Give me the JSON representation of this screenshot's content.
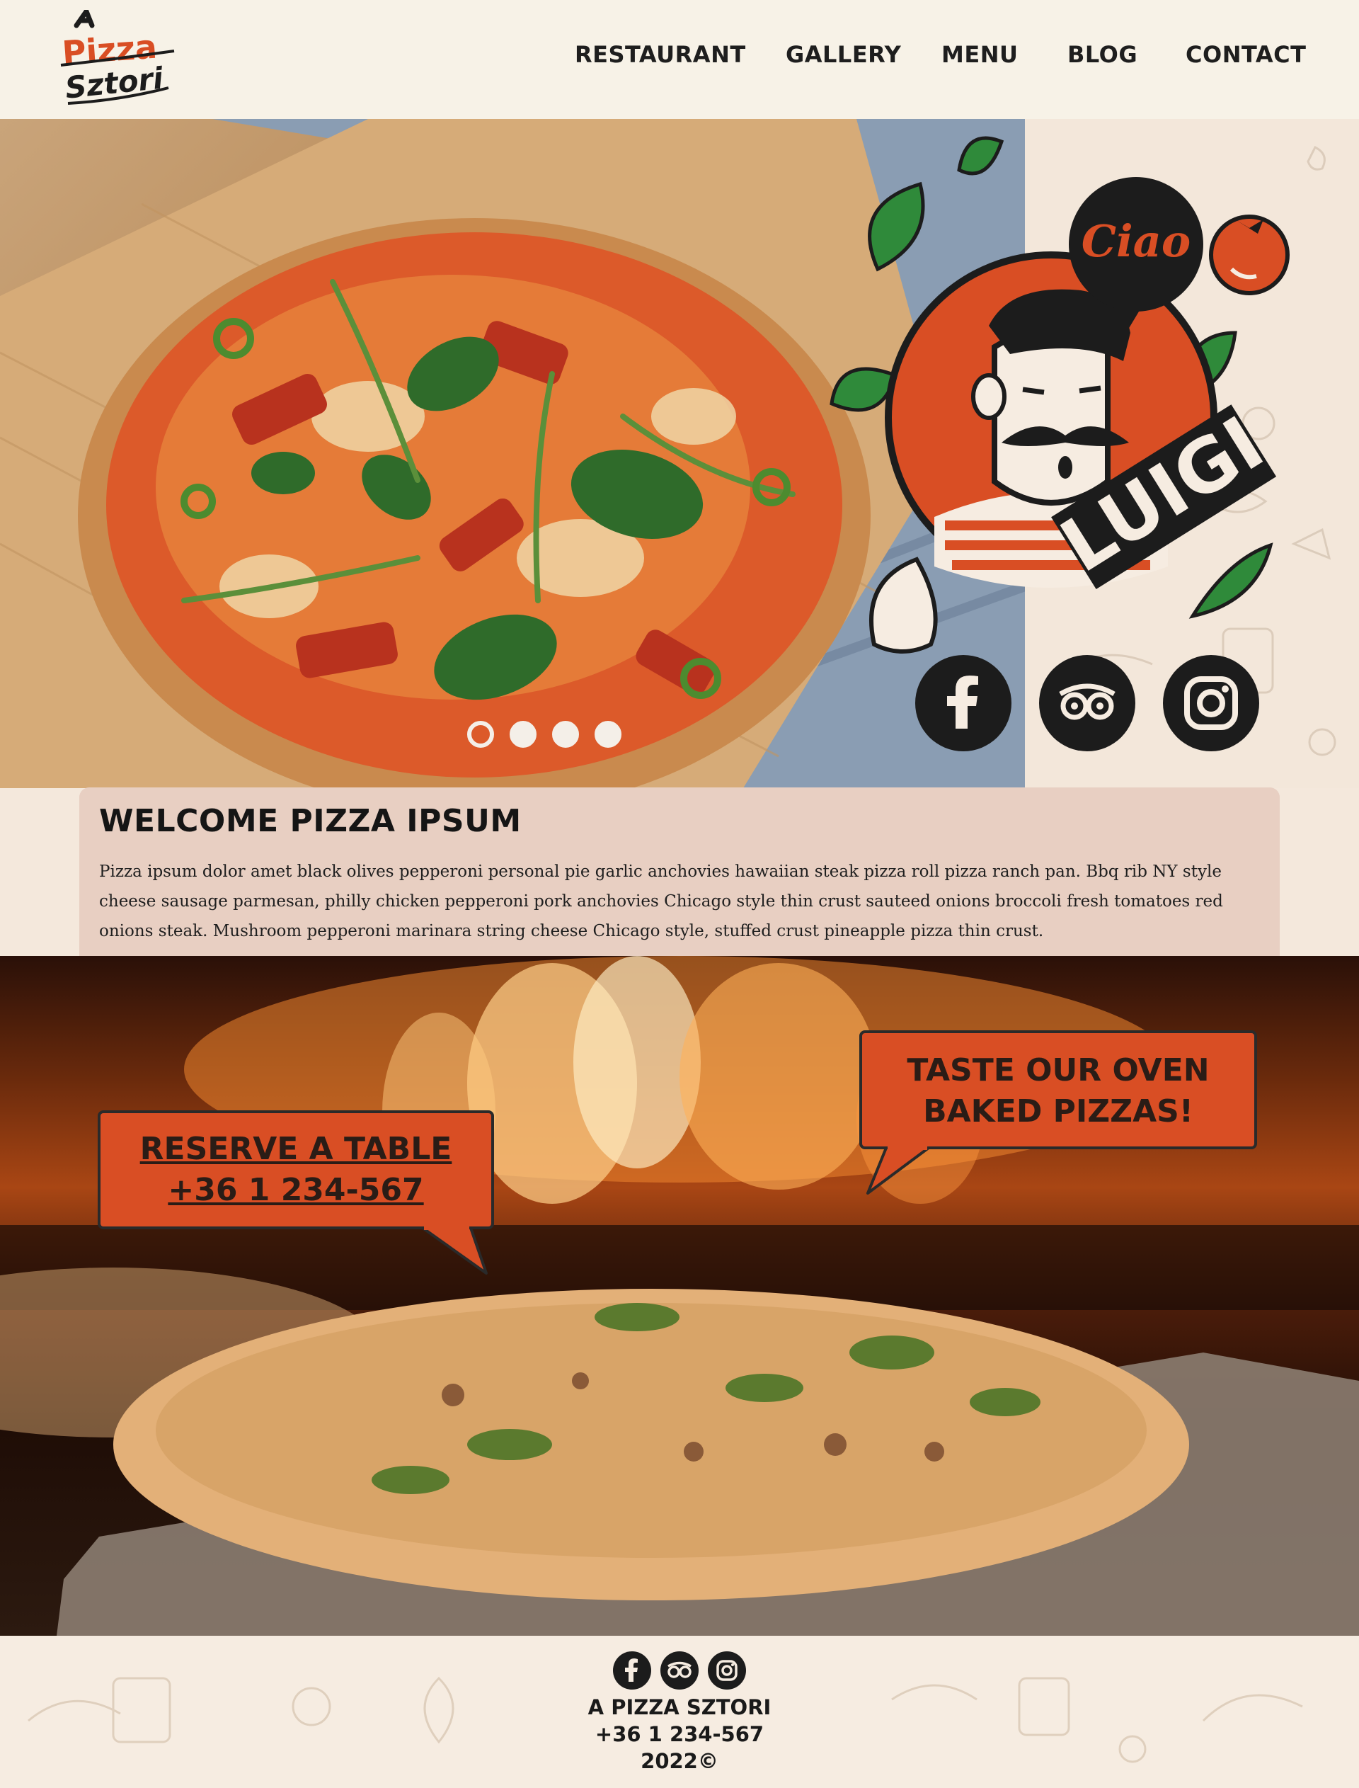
{
  "brand": {
    "logo_top": "A",
    "logo_middle": "Pizza",
    "logo_bottom": "Sztori"
  },
  "nav": {
    "items": [
      "RESTAURANT",
      "GALLERY",
      "MENU",
      "BLOG",
      "CONTACT"
    ]
  },
  "hero": {
    "slides_total": 4,
    "active_slide": 1,
    "mascot_bubble": "Ciao",
    "mascot_name": "LUIGI"
  },
  "social": [
    "facebook-icon",
    "tripadvisor-icon",
    "instagram-icon"
  ],
  "welcome": {
    "title": "WELCOME  PIZZA IPSUM",
    "body": "Pizza ipsum dolor amet black olives pepperoni personal pie garlic anchovies hawaiian steak pizza roll pizza ranch pan. Bbq rib NY style cheese sausage parmesan, philly chicken pepperoni pork anchovies Chicago style thin crust sauteed onions broccoli fresh tomatoes red onions steak. Mushroom pepperoni marinara string cheese Chicago style, stuffed crust pineapple pizza thin crust."
  },
  "reserve": {
    "line1": "RESERVE A TABLE",
    "line2": "+36 1 234-567"
  },
  "taste": {
    "line1": "TASTE OUR OVEN",
    "line2": "BAKED PIZZAS!"
  },
  "footer": {
    "name": "A PIZZA SZTORI",
    "phone": "+36 1 234-567",
    "year": "2022©"
  },
  "colors": {
    "accent": "#d94e24",
    "dark": "#1c1c1c",
    "cream": "#f6ece1",
    "welcome_bg": "#e8cfc2"
  }
}
